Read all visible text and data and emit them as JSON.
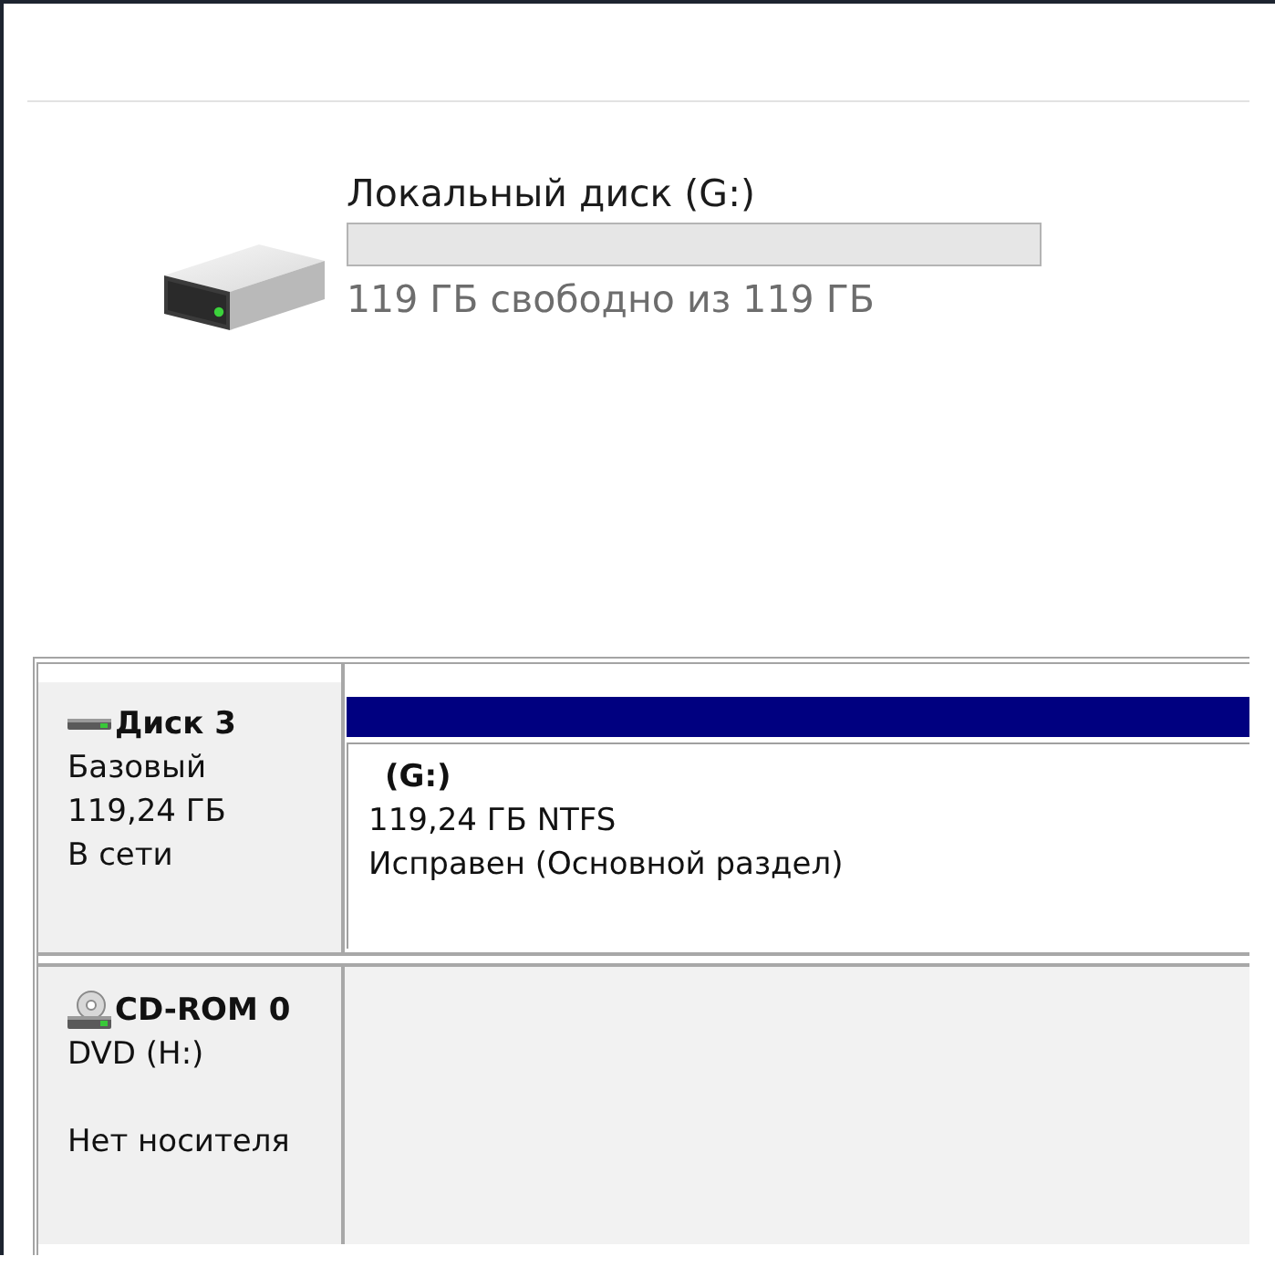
{
  "drive": {
    "title": "Локальный диск (G:)",
    "free_text": "119 ГБ свободно из 119 ГБ"
  },
  "disks": [
    {
      "kind": "disk",
      "name": "Диск 3",
      "type": "Базовый",
      "size": "119,24 ГБ",
      "status": "В сети",
      "partitions": [
        {
          "label": "(G:)",
          "size_fs": "119,24 ГБ NTFS",
          "status": "Исправен (Основной раздел)",
          "color": "#000080"
        }
      ]
    },
    {
      "kind": "cdrom",
      "name": "CD-ROM 0",
      "type": "DVD (H:)",
      "status": "Нет носителя"
    }
  ]
}
